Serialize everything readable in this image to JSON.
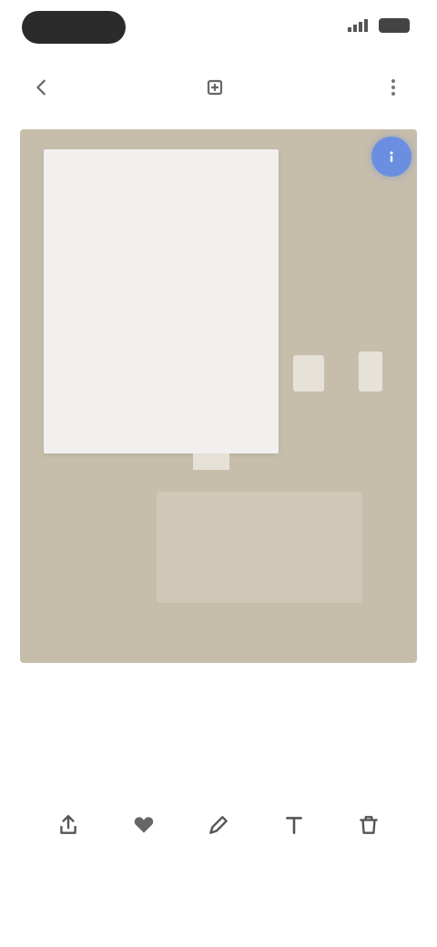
{
  "status_bar": {
    "time": "",
    "icons": [
      "signal-icon",
      "battery-icon"
    ]
  },
  "toolbar": {
    "back_icon": "back-arrow-icon",
    "edit_icon": "edit-icon",
    "more_icon": "more-icon"
  },
  "canvas": {
    "background_color": "#c7bdab",
    "paper_color": "#f1f0ee",
    "badge_color": "#6b8fe0",
    "badge_icon": "info-icon"
  },
  "actions": [
    {
      "icon": "share-icon",
      "label": ""
    },
    {
      "icon": "favorite-icon",
      "label": ""
    },
    {
      "icon": "edit-icon",
      "label": ""
    },
    {
      "icon": "text-icon",
      "label": ""
    },
    {
      "icon": "delete-icon",
      "label": ""
    }
  ]
}
